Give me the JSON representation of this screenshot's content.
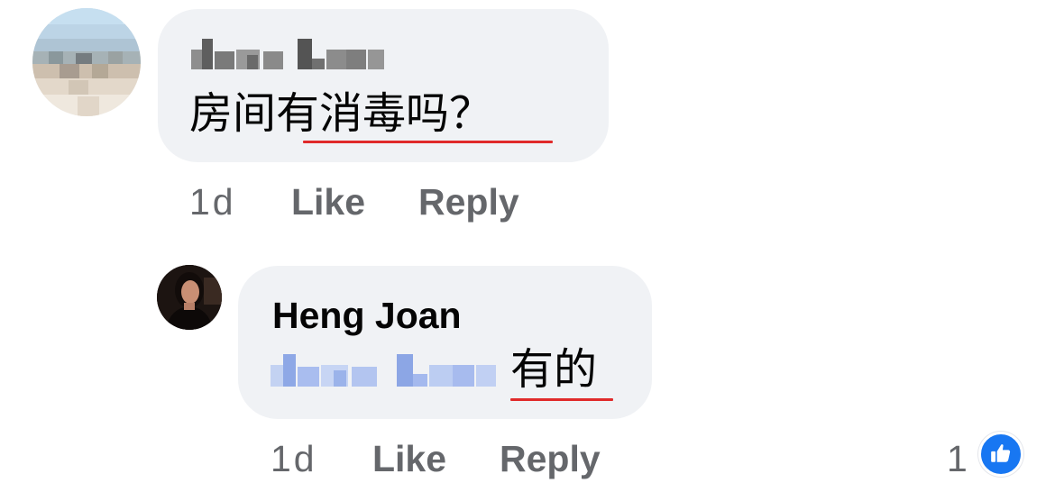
{
  "comments": [
    {
      "text": "房间有消毒吗？",
      "underlined_text": "有消毒吗",
      "time": "1d",
      "like_label": "Like",
      "reply_label": "Reply"
    },
    {
      "author": "Heng Joan",
      "text": "有的",
      "time": "1d",
      "like_label": "Like",
      "reply_label": "Reply",
      "reaction_count": "1"
    }
  ],
  "icons": {
    "reaction": "thumbs-up-icon"
  },
  "colors": {
    "bubble": "#f0f2f5",
    "meta_text": "#65676b",
    "like_blue": "#1877f2",
    "spellcheck_underline": "#e02a2a"
  }
}
